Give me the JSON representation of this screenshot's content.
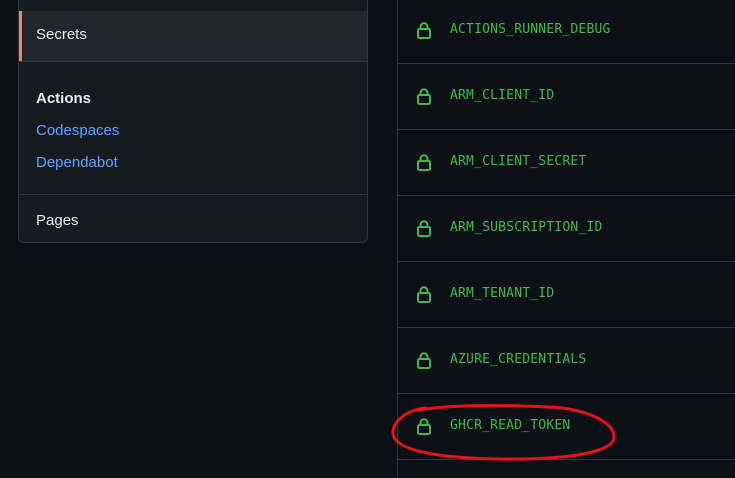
{
  "sidebar": {
    "active_item": "Secrets",
    "section_heading": "Actions",
    "links": [
      "Codespaces",
      "Dependabot"
    ],
    "footer_item": "Pages",
    "accent_color": "#f78166",
    "link_color": "#58a6ff"
  },
  "secrets": [
    {
      "name": "ACTIONS_RUNNER_DEBUG",
      "icon": "lock-icon"
    },
    {
      "name": "ARM_CLIENT_ID",
      "icon": "lock-icon"
    },
    {
      "name": "ARM_CLIENT_SECRET",
      "icon": "lock-icon"
    },
    {
      "name": "ARM_SUBSCRIPTION_ID",
      "icon": "lock-icon"
    },
    {
      "name": "ARM_TENANT_ID",
      "icon": "lock-icon"
    },
    {
      "name": "AZURE_CREDENTIALS",
      "icon": "lock-icon"
    },
    {
      "name": "GHCR_READ_TOKEN",
      "icon": "lock-icon"
    }
  ],
  "colors": {
    "background": "#0d1117",
    "secret_text": "#3fb950",
    "annotation": "#e3121b"
  }
}
